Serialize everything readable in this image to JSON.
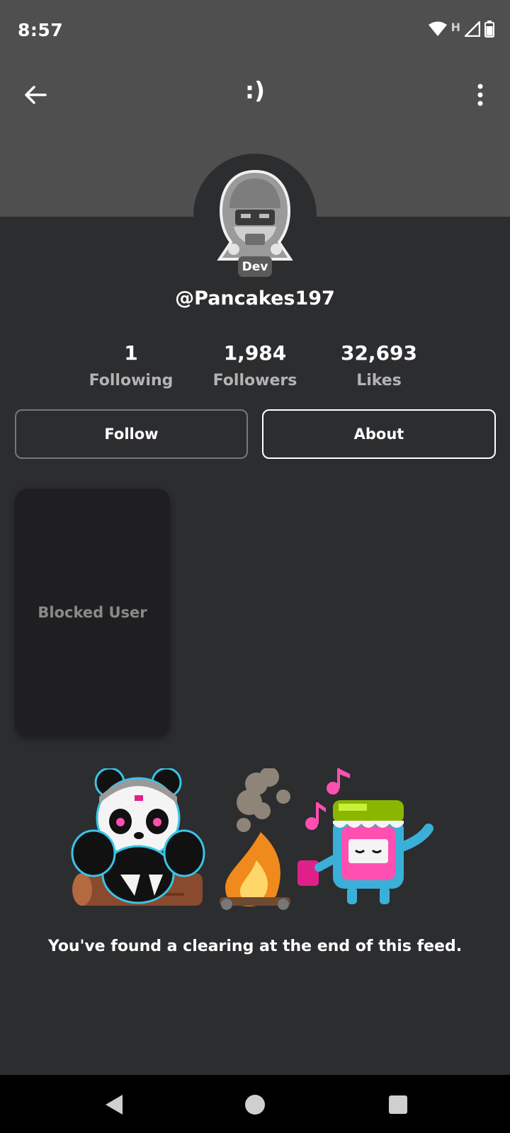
{
  "status_bar": {
    "time": "8:57",
    "network": "H",
    "icons": [
      "wifi-icon",
      "signal-icon",
      "battery-icon"
    ]
  },
  "header": {
    "title": ":)",
    "back_icon": "arrow-left-icon",
    "menu_icon": "more-vertical-icon"
  },
  "profile": {
    "badge": "Dev",
    "username": "@Pancakes197",
    "stats": [
      {
        "value": "1",
        "label": "Following"
      },
      {
        "value": "1,984",
        "label": "Followers"
      },
      {
        "value": "32,693",
        "label": "Likes"
      }
    ]
  },
  "actions": {
    "follow_label": "Follow",
    "about_label": "About"
  },
  "feed": {
    "blocked_label": "Blocked User",
    "end_message": "You've found a clearing at the end of this feed."
  },
  "colors": {
    "background": "#2c2d2f",
    "header": "#4f4f4f",
    "card": "#1f1f21",
    "muted_text": "#b3b3b3"
  }
}
